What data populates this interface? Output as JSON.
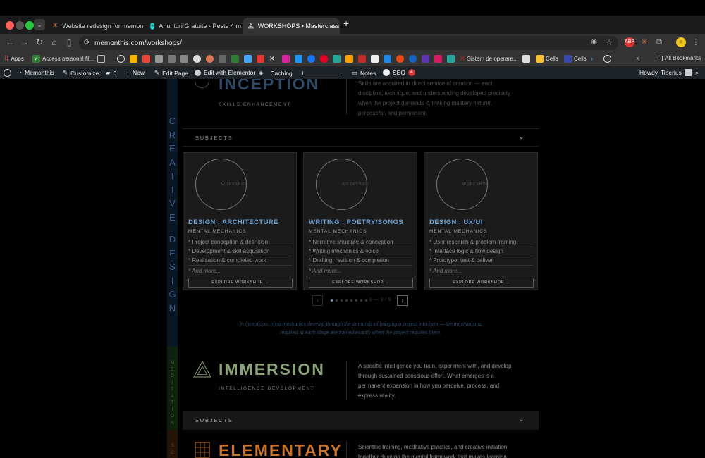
{
  "browser": {
    "tabs": [
      {
        "title": "Website redesign for memont...",
        "active": false
      },
      {
        "title": "Anunturi Gratuite - Peste 4 m...",
        "active": false
      },
      {
        "title": "WORKSHOPS • Masterclass ...",
        "active": true
      }
    ],
    "url": "memonthis.com/workshops/",
    "bookmarks": {
      "apps": "Apps",
      "access": "Access personal fil...",
      "sistem": "Sistem de operare...",
      "cells1": "Cells",
      "cells2": "Cells",
      "all": "All Bookmarks"
    }
  },
  "wpbar": {
    "site": "Memonthis",
    "customize": "Customize",
    "comments": "0",
    "new": "New",
    "edit_page": "Edit Page",
    "elementor": "Edit with Elementor",
    "caching": "Caching",
    "notes": "Notes",
    "seo": "SEO",
    "seo_badge": "4",
    "howdy": "Howdy, Tiberius"
  },
  "inception": {
    "title": "INCEPTION",
    "subtitle": "SKILLS ENHANCEMENT",
    "desc_lines": [
      "Skills are acquired in direct service of creation — each",
      "discipline, technique, and understanding developed precisely",
      "when the project demands it, making mastery natural,",
      "purposeful, and permanent."
    ],
    "subjects_label": "SUBJECTS"
  },
  "vertical": {
    "creative": [
      "C",
      "R",
      "E",
      "A",
      "T",
      "I",
      "V",
      "E"
    ],
    "design": [
      "D",
      "E",
      "S",
      "I",
      "G",
      "N"
    ],
    "meditation": [
      "M",
      "E",
      "D",
      "I",
      "T",
      "A",
      "T",
      "I",
      "O",
      "N"
    ],
    "sc": [
      "S",
      "C"
    ]
  },
  "cards": [
    {
      "placeholder": "WORKSHOP",
      "title": "DESIGN : ARCHITECTURE",
      "subtitle": "MENTAL MECHANICS",
      "items": [
        "* Project conception & definition",
        "* Development & skill acquisition",
        "* Realisation & completed work"
      ],
      "more": "* And more...",
      "button": "EXPLORE WORKSHOP →"
    },
    {
      "placeholder": "WORKSHOP",
      "title": "WRITING : POETRY/SONGS",
      "subtitle": "MENTAL MECHANICS",
      "items": [
        "* Narrative structure & conception",
        "* Writing mechanics & voice",
        "* Drafting, revision & completion"
      ],
      "more": "* And more...",
      "button": "EXPLORE WORKSHOP →"
    },
    {
      "placeholder": "WORKSHOP",
      "title": "DESIGN : UX/UI",
      "subtitle": "MENTAL MECHANICS",
      "items": [
        "* User research & problem framing",
        "* Interface logic & flow design",
        "* Prototype, test & deliver"
      ],
      "more": "* And more...",
      "button": "EXPLORE WORKSHOP →"
    }
  ],
  "carousel": {
    "counter": "1 — 3 / 9",
    "dots": 8,
    "active_dot": 1
  },
  "quote_lines": [
    "In Inceptions, mind mechanics develop through the demands of bringing a project into form — the mechanisms",
    "required at each stage are trained exactly when the project requires them."
  ],
  "immersion": {
    "title": "IMMERSION",
    "subtitle": "INTELLIGENCE DEVELOPMENT",
    "desc_lines": [
      "A specific intelligence you train, experiment with, and develop",
      "through sustained conscious effort. What emerges is a",
      "permanent expansion in how you perceive, process, and",
      "express reality."
    ],
    "subjects_label": "SUBJECTS"
  },
  "elementary": {
    "title": "ELEMENTARY",
    "desc_lines": [
      "Scientific training, meditative practice, and creative initiation",
      "together develop the mental framework that makes learning"
    ]
  },
  "colors": {
    "inception_accent": "#2f4a66",
    "immersion_accent": "#8aa377",
    "elementary_accent": "#c8742d",
    "card_title": "#6b9fd1"
  }
}
